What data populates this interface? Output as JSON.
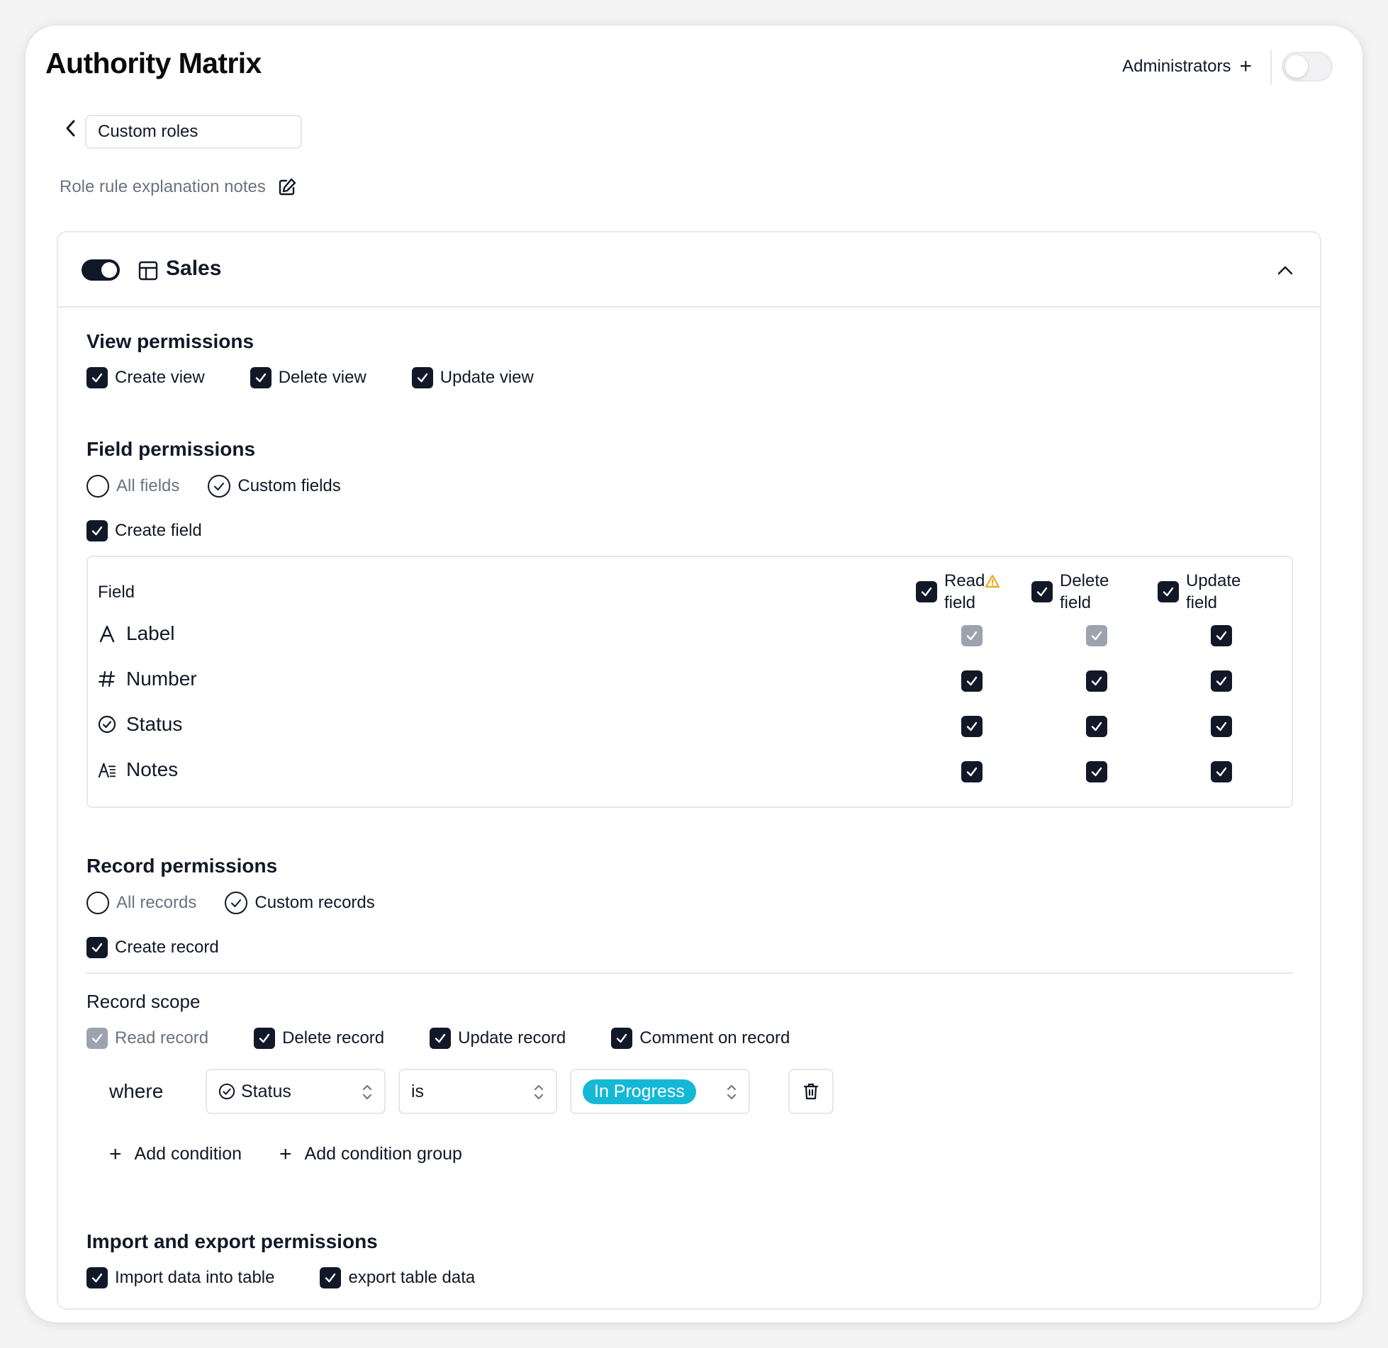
{
  "app": {
    "title": "Authority Matrix"
  },
  "header": {
    "admins_label": "Administrators",
    "toggle_on": false
  },
  "role": {
    "name": "Custom roles",
    "notes_label": "Role rule explanation notes"
  },
  "table": {
    "name": "Sales",
    "enabled": true,
    "view_permissions": {
      "title": "View permissions",
      "options": [
        {
          "label": "Create view",
          "checked": true
        },
        {
          "label": "Delete view",
          "checked": true
        },
        {
          "label": "Update view",
          "checked": true
        }
      ]
    },
    "field_permissions": {
      "title": "Field permissions",
      "scope_options": [
        {
          "label": "All fields",
          "selected": false
        },
        {
          "label": "Custom fields",
          "selected": true
        }
      ],
      "create_field_label": "Create field",
      "columns": {
        "field": "Field",
        "read_line1": "Read",
        "read_line2": "field",
        "delete_line1": "Delete",
        "delete_line2": "field",
        "update_line1": "Update",
        "update_line2": "field"
      },
      "rows": [
        {
          "name": "Label",
          "icon": "text-a-icon",
          "read": "disabled-checked",
          "delete": "disabled-checked",
          "update": "checked"
        },
        {
          "name": "Number",
          "icon": "hash-icon",
          "read": "checked",
          "delete": "checked",
          "update": "checked"
        },
        {
          "name": "Status",
          "icon": "status-check-circle-icon",
          "read": "checked",
          "delete": "checked",
          "update": "checked"
        },
        {
          "name": "Notes",
          "icon": "rich-text-icon",
          "read": "checked",
          "delete": "checked",
          "update": "checked"
        }
      ]
    },
    "record_permissions": {
      "title": "Record permissions",
      "scope_options": [
        {
          "label": "All records",
          "selected": false
        },
        {
          "label": "Custom records",
          "selected": true
        }
      ],
      "create_record_label": "Create record",
      "scope_title": "Record scope",
      "scope_actions": [
        {
          "label": "Read record",
          "checked": "disabled-checked"
        },
        {
          "label": "Delete record",
          "checked": "checked"
        },
        {
          "label": "Update record",
          "checked": "checked"
        },
        {
          "label": "Comment on record",
          "checked": "checked"
        }
      ],
      "condition": {
        "where_label": "where",
        "field": "Status",
        "operator": "is",
        "value": "In Progress",
        "value_color": "#14b8d6"
      },
      "add_condition_label": "Add condition",
      "add_group_label": "Add condition group"
    },
    "import_export": {
      "title": "Import and export permissions",
      "options": [
        {
          "label": "Import data into table",
          "checked": true
        },
        {
          "label": "export table data",
          "checked": true
        }
      ]
    }
  }
}
